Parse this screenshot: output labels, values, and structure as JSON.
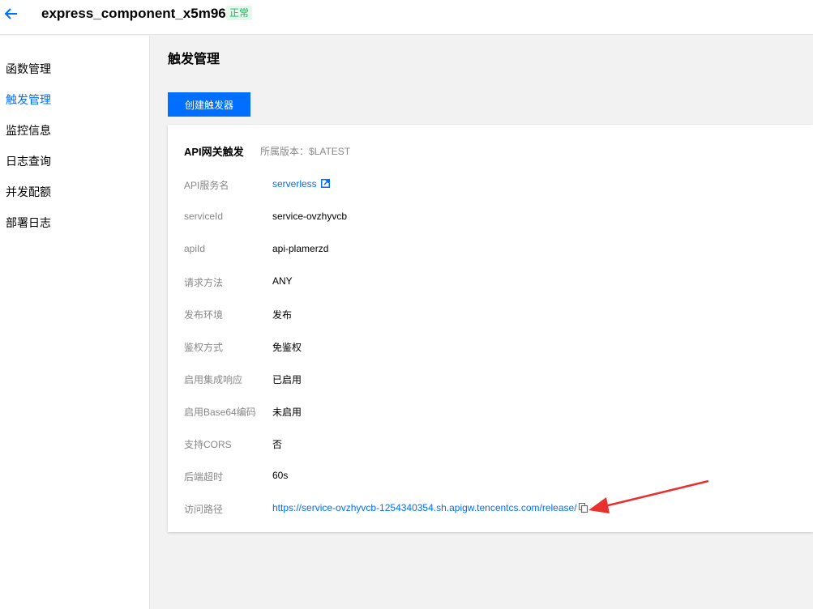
{
  "header": {
    "function_name": "express_component_x5m96k",
    "status": "正常"
  },
  "sidebar": {
    "items": [
      {
        "label": "函数管理"
      },
      {
        "label": "触发管理"
      },
      {
        "label": "监控信息"
      },
      {
        "label": "日志查询"
      },
      {
        "label": "并发配额"
      },
      {
        "label": "部署日志"
      }
    ]
  },
  "main": {
    "title": "触发管理",
    "create_button": "创建触发器"
  },
  "trigger": {
    "title": "API网关触发",
    "version": "所属版本：$LATEST",
    "fields": [
      {
        "label": "API服务名",
        "value": "serverless"
      },
      {
        "label": "serviceId",
        "value": "service-ovzhyvcb"
      },
      {
        "label": "apiId",
        "value": "api-plamerzd"
      },
      {
        "label": "请求方法",
        "value": "ANY"
      },
      {
        "label": "发布环境",
        "value": "发布"
      },
      {
        "label": "鉴权方式",
        "value": "免鉴权"
      },
      {
        "label": "启用集成响应",
        "value": "已启用"
      },
      {
        "label": "启用Base64编码",
        "value": "未启用"
      },
      {
        "label": "支持CORS",
        "value": "否"
      },
      {
        "label": "后端超时",
        "value": "60s"
      },
      {
        "label": "访问路径",
        "value": "https://service-ovzhyvcb-1254340354.sh.apigw.tencentcs.com/release/"
      }
    ]
  },
  "colors": {
    "accent": "#006eff",
    "status_green": "#0abf5b",
    "annotation_red": "#e8312f"
  }
}
